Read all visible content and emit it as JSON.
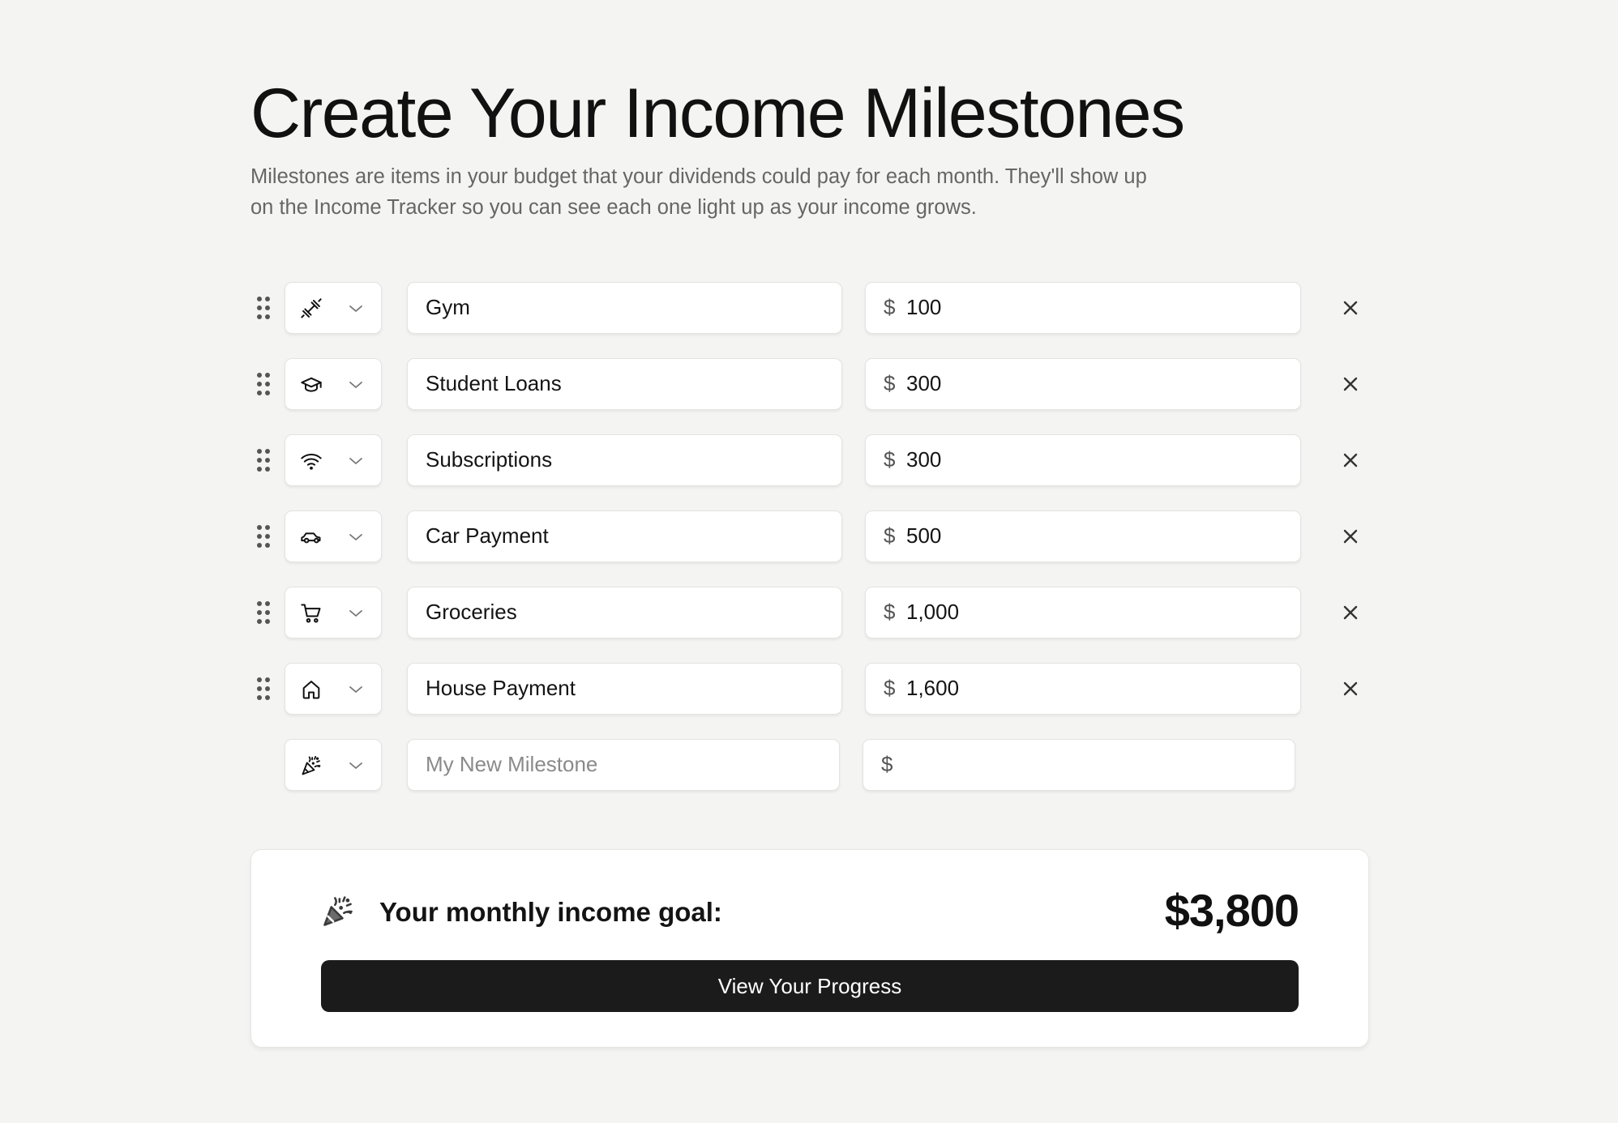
{
  "header": {
    "title": "Create Your Income Milestones",
    "subtitle": "Milestones are items in your budget that your dividends could pay for each month. They'll show up on the Income Tracker so you can see each one light up as your income grows."
  },
  "milestones": [
    {
      "icon": "dumbbell-icon",
      "name": "Gym",
      "currency": "$",
      "amount": "100"
    },
    {
      "icon": "graduation-cap-icon",
      "name": "Student Loans",
      "currency": "$",
      "amount": "300"
    },
    {
      "icon": "wifi-icon",
      "name": "Subscriptions",
      "currency": "$",
      "amount": "300"
    },
    {
      "icon": "car-icon",
      "name": "Car Payment",
      "currency": "$",
      "amount": "500"
    },
    {
      "icon": "shopping-cart-icon",
      "name": "Groceries",
      "currency": "$",
      "amount": "1,000"
    },
    {
      "icon": "house-icon",
      "name": "House Payment",
      "currency": "$",
      "amount": "1,600"
    }
  ],
  "new_milestone": {
    "icon": "party-popper-icon",
    "name_placeholder": "My New Milestone",
    "currency": "$",
    "amount_value": ""
  },
  "goal": {
    "icon": "party-popper-icon",
    "label": "Your monthly income goal:",
    "amount": "$3,800",
    "button_label": "View Your Progress"
  },
  "colors": {
    "background": "#f4f4f2",
    "card": "#ffffff",
    "button": "#1b1b1b",
    "text": "#141414",
    "muted": "#666666"
  }
}
